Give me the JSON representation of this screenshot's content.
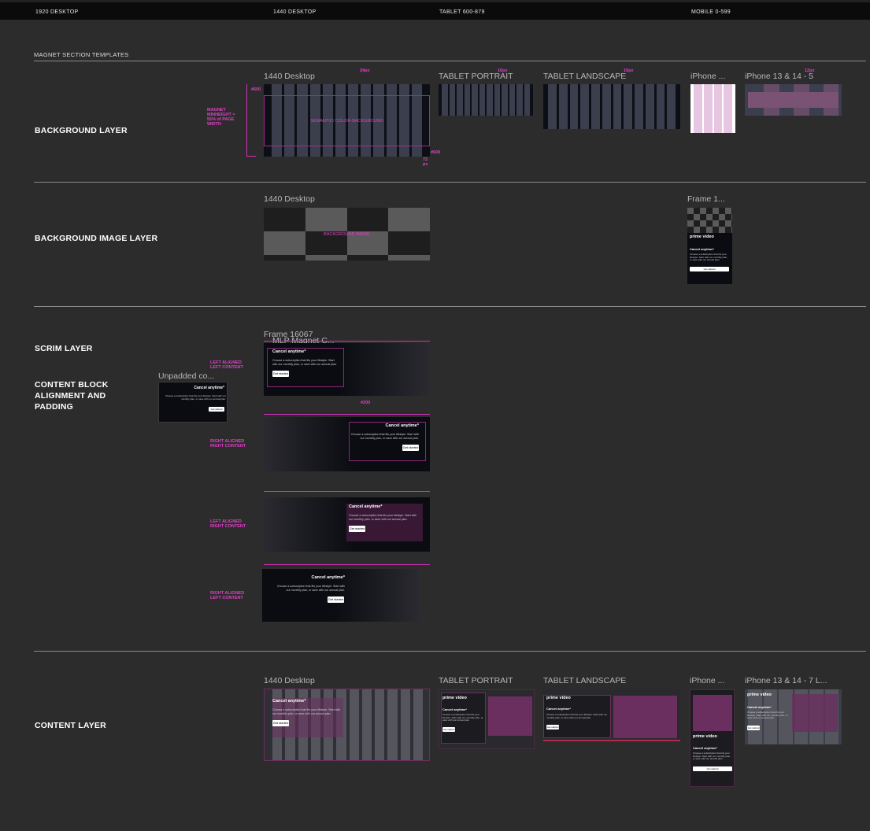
{
  "topbar": {
    "breakpoints": [
      "1920 DESKTOP",
      "1440 DESKTOP",
      "TABLET 600-879",
      "MOBILE 0-599"
    ]
  },
  "section_title": "MAGNET SECTION TEMPLATES",
  "rows": {
    "background_layer": {
      "label": "BACKGROUND LAYER",
      "frames": [
        "1440 Desktop",
        "TABLET PORTRAIT",
        "TABLET LANDSCAPE",
        "iPhone ...",
        "iPhone 13 & 14 - 5"
      ],
      "annotations": {
        "minheight": "MAGNET MINHEIGHT = 55% of PAGE WIDTH",
        "bg_token": "SEMANTIC/ COLOR-BACKGROUND",
        "gap_24": "24px",
        "gap_16a": "16px",
        "gap_16b": "16px",
        "gap_12": "12px",
        "size_600a": "#600",
        "size_600b": "#600",
        "size_72": "72 px"
      }
    },
    "background_image_layer": {
      "label": "BACKGROUND IMAGE LAYER",
      "frames": [
        "1440 Desktop",
        "Frame 1..."
      ],
      "annotations": {
        "bg_image": "BACKGROUND IMAGE"
      },
      "mobile_card": {
        "brand": "prime video",
        "title": "Cancel anytime*",
        "body": "Choose a subscription that fits your lifestyle. Start with our monthly plan, or save with our annual plan.",
        "button": "Get started"
      }
    },
    "scrim_layer": {
      "label": "SCRIM LAYER",
      "label2": "CONTENT BLOCK ALIGNMENT AND PADDING",
      "frame_name": "Frame 16067",
      "inner_frame": "MLP Magnet C...",
      "unpadded": "Unpadded co...",
      "annotations": {
        "left_left": "LEFT ALIGNED LEFT CONTENT",
        "right_right": "RIGHT ALIGNED RIGHT CONTENT",
        "left_right": "LEFT ALIGNED RIGHT CONTENT",
        "right_left": "RIGHT ALIGNED LEFT CONTENT",
        "gap_200": "#200"
      },
      "card": {
        "title": "Cancel anytime*",
        "body": "Choose a subscription that fits your lifestyle. Start with our monthly plan, or save with our annual plan.",
        "button": "Get started"
      }
    },
    "content_layer": {
      "label": "CONTENT LAYER",
      "frames": [
        "1440 Desktop",
        "TABLET PORTRAIT",
        "TABLET LANDSCAPE",
        "iPhone ...",
        "iPhone 13 & 14 - 7 L..."
      ],
      "card": {
        "brand": "prime video",
        "title": "Cancel anytime*",
        "body": "Choose a subscription that fits your lifestyle. Start with our monthly plan, or save with our annual plan.",
        "button": "Get started"
      }
    }
  },
  "colors": {
    "canvas": "#2c2c2c",
    "annotation": "#e040c8",
    "column": "#3b3f4d",
    "content_fill": "#6a2f5e"
  }
}
